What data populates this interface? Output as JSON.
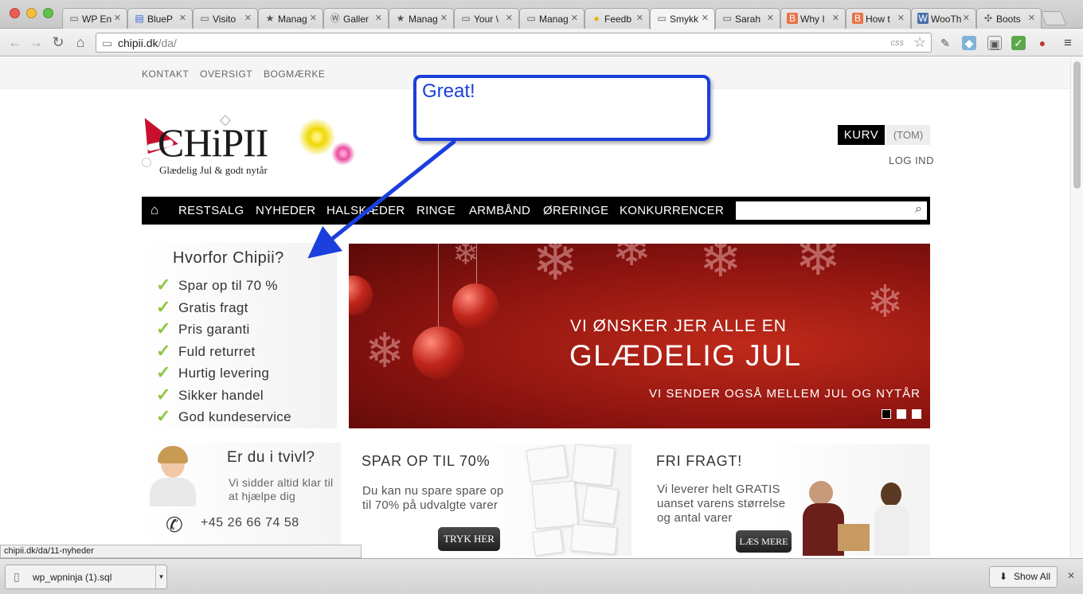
{
  "browser": {
    "tabs": [
      {
        "label": "WP En",
        "icon": "page-icon"
      },
      {
        "label": "BlueP",
        "icon": "doc-icon"
      },
      {
        "label": "Visito",
        "icon": "page-icon"
      },
      {
        "label": "Manag",
        "icon": "star-icon"
      },
      {
        "label": "Galler",
        "icon": "wordpress-icon"
      },
      {
        "label": "Manag",
        "icon": "star-icon"
      },
      {
        "label": "Your \\",
        "icon": "page-icon"
      },
      {
        "label": "Manag",
        "icon": "page-icon"
      },
      {
        "label": "Feedb",
        "icon": "bulb-icon"
      },
      {
        "label": "Smykk",
        "icon": "page-icon",
        "active": true
      },
      {
        "label": "Sarah",
        "icon": "page-icon"
      },
      {
        "label": "Why I",
        "icon": "blogger-icon"
      },
      {
        "label": "How t",
        "icon": "blogger-icon"
      },
      {
        "label": "WooTh",
        "icon": "woo-icon"
      },
      {
        "label": "Boots",
        "icon": "bootstrap-icon"
      }
    ],
    "url_host": "chipii.dk",
    "url_path": "/da/",
    "omnibox_badge": "css",
    "status_url": "chipii.dk/da/11-nyheder",
    "download_file": "wp_wpninja (1).sql",
    "show_all": "Show All"
  },
  "site": {
    "top_links": [
      "KONTAKT",
      "OVERSIGT",
      "BOGMÆRKE"
    ],
    "logo": {
      "brand": "CHiPII",
      "tagline": "Glædelig Jul & godt nytår"
    },
    "cart": {
      "label": "KURV",
      "status": "(TOM)"
    },
    "login": "LOG IND",
    "nav": [
      "RESTSALG",
      "NYHEDER",
      "HALSKÆDER",
      "RINGE",
      "ARMBÅND",
      "ØRERINGE",
      "KONKURRENCER"
    ],
    "search_placeholder": "",
    "why": {
      "title": "Hvorfor Chipii?",
      "items": [
        "Spar op til 70 %",
        "Gratis fragt",
        "Pris garanti",
        "Fuld returret",
        "Hurtig levering",
        "Sikker handel",
        "God kundeservice"
      ]
    },
    "banner": {
      "line1": "VI ØNSKER JER ALLE EN",
      "line2": "GLÆDELIG JUL",
      "line3": "VI SENDER OGSÅ MELLEM JUL OG NYTÅR",
      "active_slide": 1,
      "slide_count": 3
    },
    "help": {
      "title": "Er du i tvivl?",
      "text": "Vi sidder altid klar til at hjælpe dig",
      "phone": "+45 26 66 74 58"
    },
    "promo1": {
      "title": "SPAR OP TIL 70%",
      "line1": "Du kan nu spare spare op",
      "line2": "til 70% på udvalgte varer",
      "button": "TRYK HER"
    },
    "promo2": {
      "title": "FRI FRAGT!",
      "line1": "Vi leverer helt GRATIS",
      "line2": "uanset varens størrelse",
      "line3": "og antal varer",
      "button": "LÆS MERE"
    }
  },
  "annotation": {
    "text": "Great!",
    "color": "#1a3fdc"
  },
  "colors": {
    "nav_bg": "#000000",
    "check": "#8cc63f",
    "banner": "#8e1410"
  }
}
